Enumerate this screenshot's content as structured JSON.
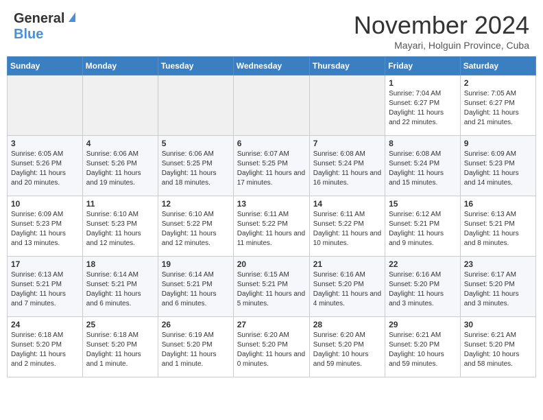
{
  "header": {
    "logo_general": "General",
    "logo_blue": "Blue",
    "month_title": "November 2024",
    "subtitle": "Mayari, Holguin Province, Cuba"
  },
  "days_of_week": [
    "Sunday",
    "Monday",
    "Tuesday",
    "Wednesday",
    "Thursday",
    "Friday",
    "Saturday"
  ],
  "weeks": [
    [
      {
        "day": "",
        "info": ""
      },
      {
        "day": "",
        "info": ""
      },
      {
        "day": "",
        "info": ""
      },
      {
        "day": "",
        "info": ""
      },
      {
        "day": "",
        "info": ""
      },
      {
        "day": "1",
        "info": "Sunrise: 7:04 AM\nSunset: 6:27 PM\nDaylight: 11 hours and 22 minutes."
      },
      {
        "day": "2",
        "info": "Sunrise: 7:05 AM\nSunset: 6:27 PM\nDaylight: 11 hours and 21 minutes."
      }
    ],
    [
      {
        "day": "3",
        "info": "Sunrise: 6:05 AM\nSunset: 5:26 PM\nDaylight: 11 hours and 20 minutes."
      },
      {
        "day": "4",
        "info": "Sunrise: 6:06 AM\nSunset: 5:26 PM\nDaylight: 11 hours and 19 minutes."
      },
      {
        "day": "5",
        "info": "Sunrise: 6:06 AM\nSunset: 5:25 PM\nDaylight: 11 hours and 18 minutes."
      },
      {
        "day": "6",
        "info": "Sunrise: 6:07 AM\nSunset: 5:25 PM\nDaylight: 11 hours and 17 minutes."
      },
      {
        "day": "7",
        "info": "Sunrise: 6:08 AM\nSunset: 5:24 PM\nDaylight: 11 hours and 16 minutes."
      },
      {
        "day": "8",
        "info": "Sunrise: 6:08 AM\nSunset: 5:24 PM\nDaylight: 11 hours and 15 minutes."
      },
      {
        "day": "9",
        "info": "Sunrise: 6:09 AM\nSunset: 5:23 PM\nDaylight: 11 hours and 14 minutes."
      }
    ],
    [
      {
        "day": "10",
        "info": "Sunrise: 6:09 AM\nSunset: 5:23 PM\nDaylight: 11 hours and 13 minutes."
      },
      {
        "day": "11",
        "info": "Sunrise: 6:10 AM\nSunset: 5:23 PM\nDaylight: 11 hours and 12 minutes."
      },
      {
        "day": "12",
        "info": "Sunrise: 6:10 AM\nSunset: 5:22 PM\nDaylight: 11 hours and 12 minutes."
      },
      {
        "day": "13",
        "info": "Sunrise: 6:11 AM\nSunset: 5:22 PM\nDaylight: 11 hours and 11 minutes."
      },
      {
        "day": "14",
        "info": "Sunrise: 6:11 AM\nSunset: 5:22 PM\nDaylight: 11 hours and 10 minutes."
      },
      {
        "day": "15",
        "info": "Sunrise: 6:12 AM\nSunset: 5:21 PM\nDaylight: 11 hours and 9 minutes."
      },
      {
        "day": "16",
        "info": "Sunrise: 6:13 AM\nSunset: 5:21 PM\nDaylight: 11 hours and 8 minutes."
      }
    ],
    [
      {
        "day": "17",
        "info": "Sunrise: 6:13 AM\nSunset: 5:21 PM\nDaylight: 11 hours and 7 minutes."
      },
      {
        "day": "18",
        "info": "Sunrise: 6:14 AM\nSunset: 5:21 PM\nDaylight: 11 hours and 6 minutes."
      },
      {
        "day": "19",
        "info": "Sunrise: 6:14 AM\nSunset: 5:21 PM\nDaylight: 11 hours and 6 minutes."
      },
      {
        "day": "20",
        "info": "Sunrise: 6:15 AM\nSunset: 5:21 PM\nDaylight: 11 hours and 5 minutes."
      },
      {
        "day": "21",
        "info": "Sunrise: 6:16 AM\nSunset: 5:20 PM\nDaylight: 11 hours and 4 minutes."
      },
      {
        "day": "22",
        "info": "Sunrise: 6:16 AM\nSunset: 5:20 PM\nDaylight: 11 hours and 3 minutes."
      },
      {
        "day": "23",
        "info": "Sunrise: 6:17 AM\nSunset: 5:20 PM\nDaylight: 11 hours and 3 minutes."
      }
    ],
    [
      {
        "day": "24",
        "info": "Sunrise: 6:18 AM\nSunset: 5:20 PM\nDaylight: 11 hours and 2 minutes."
      },
      {
        "day": "25",
        "info": "Sunrise: 6:18 AM\nSunset: 5:20 PM\nDaylight: 11 hours and 1 minute."
      },
      {
        "day": "26",
        "info": "Sunrise: 6:19 AM\nSunset: 5:20 PM\nDaylight: 11 hours and 1 minute."
      },
      {
        "day": "27",
        "info": "Sunrise: 6:20 AM\nSunset: 5:20 PM\nDaylight: 11 hours and 0 minutes."
      },
      {
        "day": "28",
        "info": "Sunrise: 6:20 AM\nSunset: 5:20 PM\nDaylight: 10 hours and 59 minutes."
      },
      {
        "day": "29",
        "info": "Sunrise: 6:21 AM\nSunset: 5:20 PM\nDaylight: 10 hours and 59 minutes."
      },
      {
        "day": "30",
        "info": "Sunrise: 6:21 AM\nSunset: 5:20 PM\nDaylight: 10 hours and 58 minutes."
      }
    ]
  ]
}
